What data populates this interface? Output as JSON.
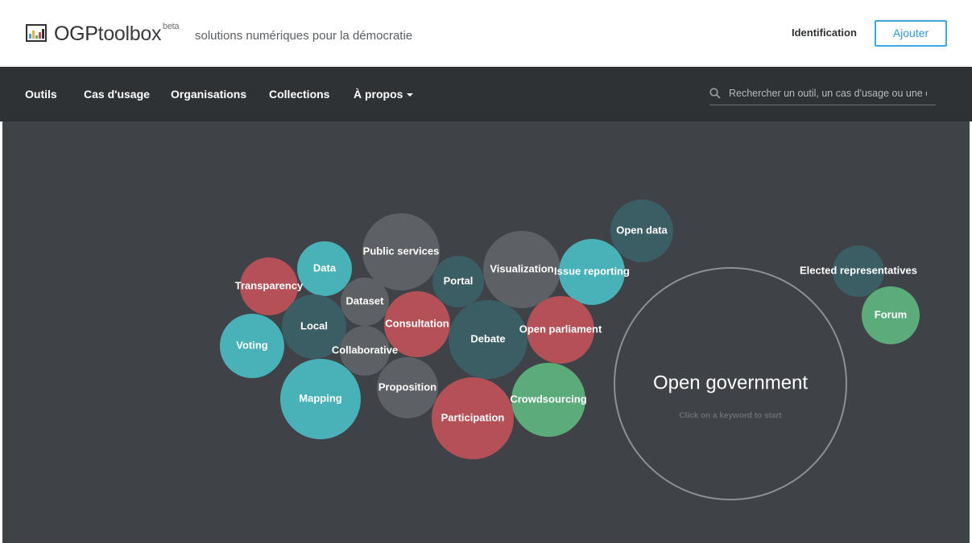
{
  "header": {
    "brand_bold": "OGP",
    "brand_light": "toolbox",
    "beta": "beta",
    "tagline": "solutions numériques pour la démocratie",
    "login_label": "Identification",
    "add_button": "Ajouter"
  },
  "nav": {
    "items": [
      "Outils",
      "Cas d'usage",
      "Organisations",
      "Collections",
      "À propos"
    ],
    "search_placeholder": "Rechercher un outil, un cas d'usage ou une organisation"
  },
  "colors": {
    "teal": "#48b2b8",
    "dark_teal": "#3b5d64",
    "red": "#b35157",
    "gray": "#5d6064",
    "green": "#5bab7b",
    "accent": "#3aa8e0"
  },
  "focus": {
    "title": "Open government",
    "hint": "Click on a keyword to start"
  },
  "keywords": [
    {
      "label": "Open data",
      "color": "dark_teal"
    },
    {
      "label": "Public services",
      "color": "gray"
    },
    {
      "label": "Data",
      "color": "teal"
    },
    {
      "label": "Transparency",
      "color": "red"
    },
    {
      "label": "Portal",
      "color": "dark_teal"
    },
    {
      "label": "Visualization",
      "color": "gray"
    },
    {
      "label": "Issue reporting",
      "color": "teal"
    },
    {
      "label": "Dataset",
      "color": "gray"
    },
    {
      "label": "Local",
      "color": "dark_teal"
    },
    {
      "label": "Consultation",
      "color": "red"
    },
    {
      "label": "Debate",
      "color": "dark_teal"
    },
    {
      "label": "Open parliament",
      "color": "red"
    },
    {
      "label": "Voting",
      "color": "teal"
    },
    {
      "label": "Collaborative",
      "color": "gray"
    },
    {
      "label": "Proposition",
      "color": "gray"
    },
    {
      "label": "Mapping",
      "color": "teal"
    },
    {
      "label": "Participation",
      "color": "red"
    },
    {
      "label": "Crowdsourcing",
      "color": "green"
    },
    {
      "label": "Elected representatives",
      "color": "dark_teal"
    },
    {
      "label": "Forum",
      "color": "green"
    }
  ]
}
